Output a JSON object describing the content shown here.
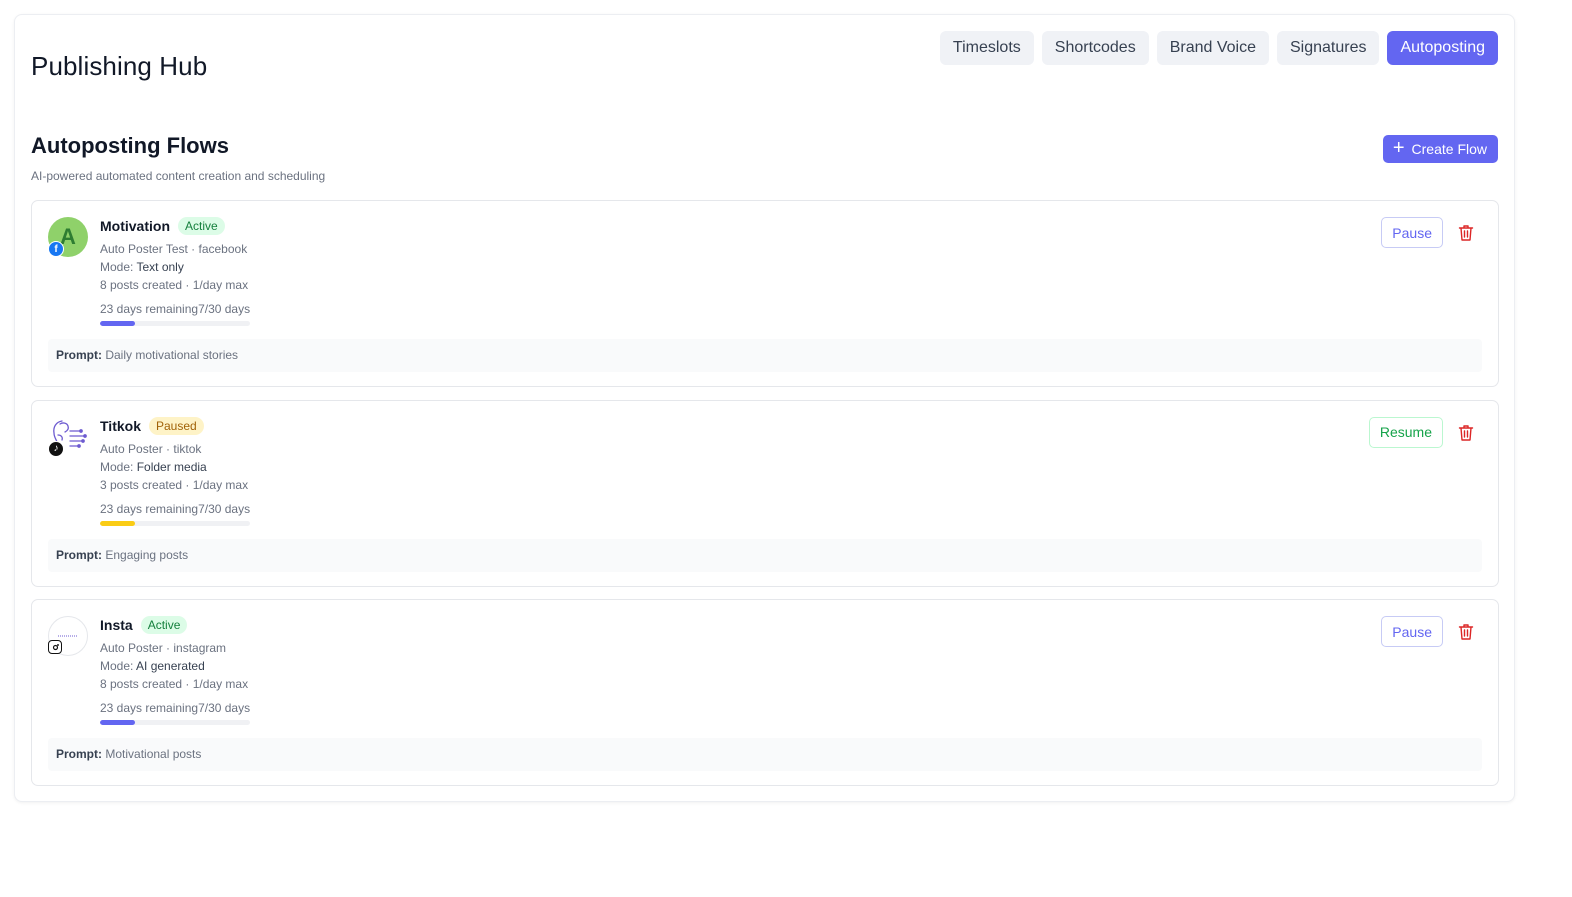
{
  "header": {
    "title": "Publishing Hub",
    "tabs": [
      {
        "label": "Timeslots",
        "active": false
      },
      {
        "label": "Shortcodes",
        "active": false
      },
      {
        "label": "Brand Voice",
        "active": false
      },
      {
        "label": "Signatures",
        "active": false
      },
      {
        "label": "Autoposting",
        "active": true
      }
    ]
  },
  "section": {
    "title": "Autoposting Flows",
    "subtitle": "AI-powered automated content creation and scheduling",
    "create_label": "Create Flow"
  },
  "colors": {
    "accent": "#6366f1",
    "active_badge": "#dcfce7",
    "paused_badge": "#fef3c7",
    "paused_progress": "#facc15",
    "delete": "#dc2626"
  },
  "flows": [
    {
      "name": "Motivation",
      "status": "Active",
      "account": "Auto Poster Test · facebook",
      "mode_label": "Mode:",
      "mode": "Text only",
      "stats": "8 posts created · 1/day max",
      "remaining": "23 days remaining",
      "progress_text": "7/30 days",
      "progress": 0.233,
      "avatar_letter": "A",
      "platform_icon": "facebook-icon",
      "prompt_label": "Prompt:",
      "prompt": "Daily motivational stories",
      "action_label": "Pause"
    },
    {
      "name": "Titkok",
      "status": "Paused",
      "account": "Auto Poster · tiktok",
      "mode_label": "Mode:",
      "mode": "Folder media",
      "stats": "3 posts created · 1/day max",
      "remaining": "23 days remaining",
      "progress_text": "7/30 days",
      "progress": 0.233,
      "platform_icon": "tiktok-icon",
      "prompt_label": "Prompt:",
      "prompt": "Engaging posts",
      "action_label": "Resume"
    },
    {
      "name": "Insta",
      "status": "Active",
      "account": "Auto Poster · instagram",
      "mode_label": "Mode:",
      "mode": "AI generated",
      "stats": "8 posts created · 1/day max",
      "remaining": "23 days remaining",
      "progress_text": "7/30 days",
      "progress": 0.233,
      "platform_icon": "instagram-icon",
      "prompt_label": "Prompt:",
      "prompt": "Motivational posts",
      "action_label": "Pause"
    }
  ]
}
